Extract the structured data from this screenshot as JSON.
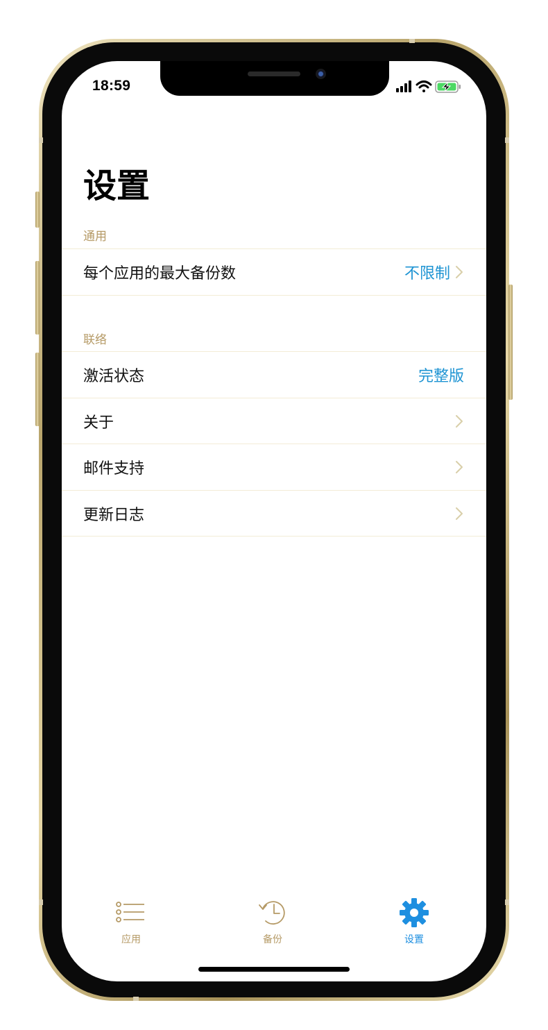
{
  "status_bar": {
    "time": "18:59",
    "signal_icon": "cellular-signal-icon",
    "wifi_icon": "wifi-icon",
    "battery_icon": "battery-charging-icon"
  },
  "page": {
    "title": "设置"
  },
  "sections": {
    "general": {
      "header": "通用",
      "rows": [
        {
          "label": "每个应用的最大备份数",
          "value": "不限制"
        }
      ]
    },
    "contact": {
      "header": "联络",
      "rows": [
        {
          "label": "激活状态",
          "value": "完整版"
        },
        {
          "label": "关于"
        },
        {
          "label": "邮件支持"
        },
        {
          "label": "更新日志"
        }
      ]
    }
  },
  "tab_bar": {
    "tabs": [
      {
        "label": "应用",
        "icon": "list-icon",
        "selected": false
      },
      {
        "label": "备份",
        "icon": "history-clock-icon",
        "selected": false
      },
      {
        "label": "设置",
        "icon": "gear-icon",
        "selected": true
      }
    ]
  },
  "colors": {
    "accent_blue": "#1e94d3",
    "tab_selected": "#1e8fe0",
    "section_header": "#b59a66",
    "chevron": "#d9cfa9",
    "frame_gold": "#c9b47e"
  }
}
